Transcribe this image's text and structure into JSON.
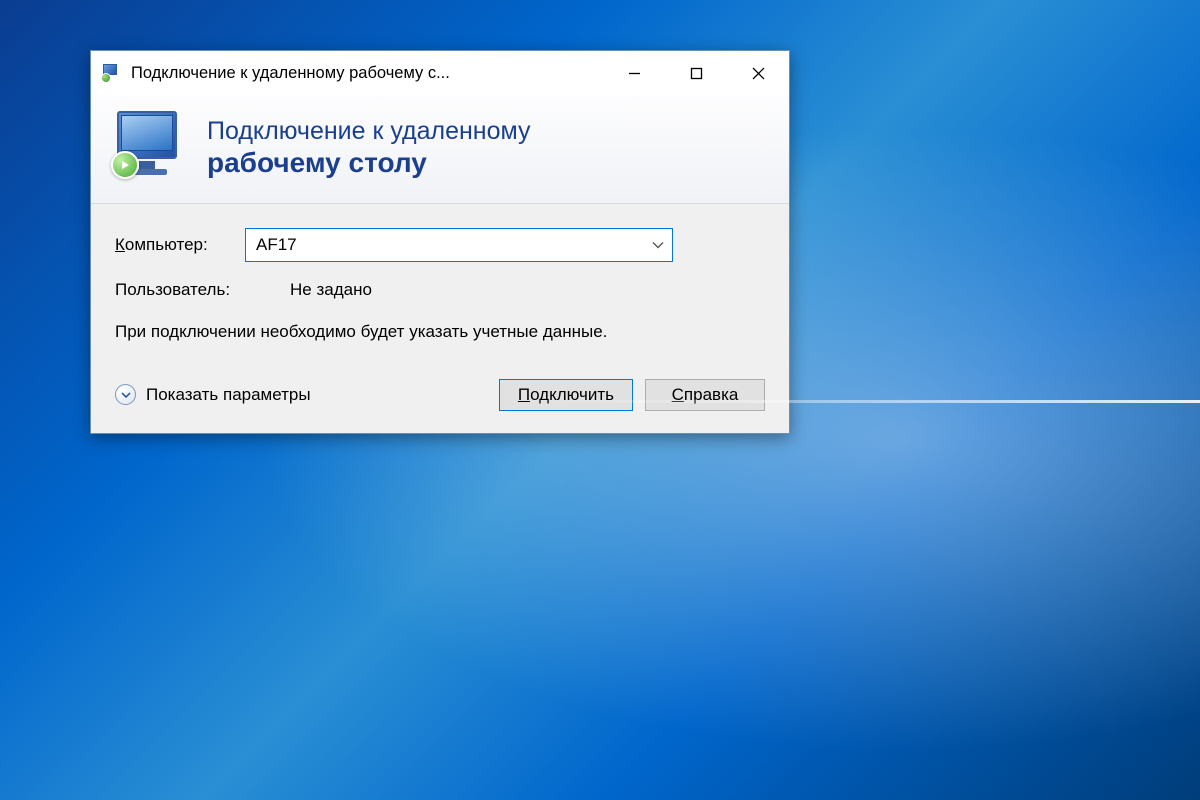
{
  "window": {
    "title": "Подключение к удаленному рабочему с..."
  },
  "header": {
    "line1": "Подключение к удаленному",
    "line2": "рабочему столу"
  },
  "form": {
    "computer_label_prefix": "К",
    "computer_label_rest": "омпьютер:",
    "computer_value": "AF17",
    "user_label": "Пользователь:",
    "user_value": "Не задано",
    "hint": "При подключении необходимо будет указать учетные данные."
  },
  "footer": {
    "show_options_prefix": "П",
    "show_options_rest": "оказать параметры",
    "connect_prefix": "П",
    "connect_rest": "одключить",
    "help_prefix": "С",
    "help_rest": "правка"
  }
}
